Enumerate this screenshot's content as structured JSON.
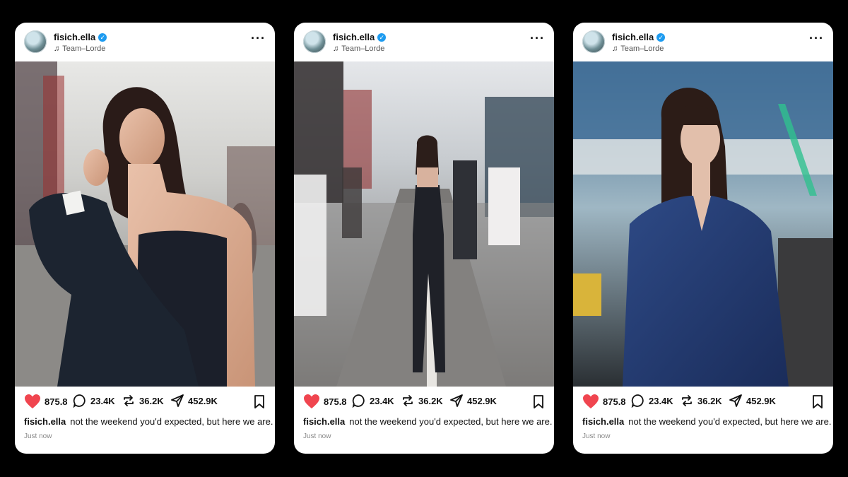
{
  "posts": [
    {
      "username": "fisich.ella",
      "music": "Team–Lorde",
      "likes": "875.8",
      "comments": "23.4K",
      "reposts": "36.2K",
      "shares": "452.9K",
      "caption_user": "fisich.ella",
      "caption_text": "not the weekend you'd expected, but here we are.",
      "timestamp": "Just now",
      "photo_desc": "woman in strapless dark dress holding blazer over shoulder"
    },
    {
      "username": "fisich.ella",
      "music": "Team–Lorde",
      "likes": "875.8",
      "comments": "23.4K",
      "reposts": "36.2K",
      "shares": "452.9K",
      "caption_user": "fisich.ella",
      "caption_text": "not the weekend you'd expected, but here we are.",
      "timestamp": "Just now",
      "photo_desc": "woman walking down paddock in dark strapless outfit"
    },
    {
      "username": "fisich.ella",
      "music": "Team–Lorde",
      "likes": "875.8",
      "comments": "23.4K",
      "reposts": "36.2K",
      "shares": "452.9K",
      "caption_user": "fisich.ella",
      "caption_text": "not the weekend you'd expected, but here we are.",
      "timestamp": "Just now",
      "photo_desc": "woman with braids in blue satin blouse"
    }
  ],
  "colors": {
    "like": "#f0454f",
    "verified": "#1d9bf0",
    "background": "#000000"
  },
  "icons": [
    "heart-icon",
    "comment-icon",
    "repost-icon",
    "share-icon",
    "bookmark-icon",
    "more-icon",
    "music-note-icon",
    "verified-badge-icon"
  ]
}
